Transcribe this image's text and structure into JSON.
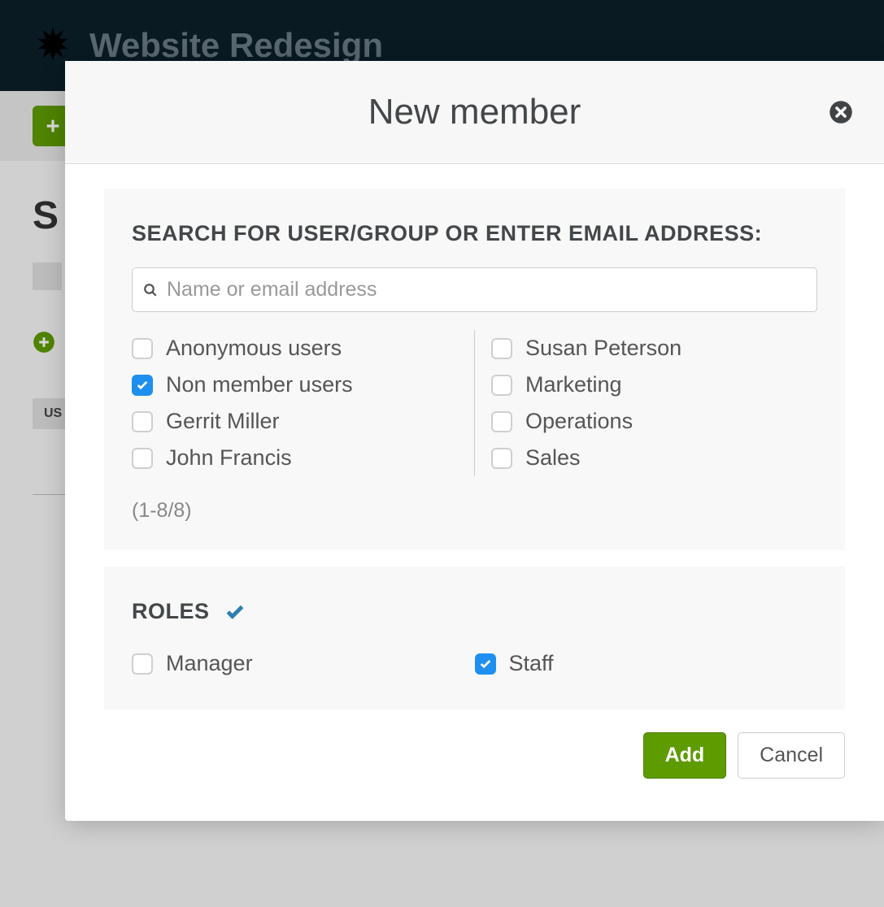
{
  "background": {
    "project_title": "Website Redesign",
    "heading_partial": "S",
    "tab_partial": "",
    "us_tab": "US"
  },
  "modal": {
    "title": "New member",
    "search_section": {
      "label": "SEARCH FOR USER/GROUP OR ENTER EMAIL ADDRESS:",
      "placeholder": "Name or email address",
      "value": ""
    },
    "users_left": [
      {
        "label": "Anonymous users",
        "checked": false
      },
      {
        "label": "Non member users",
        "checked": true
      },
      {
        "label": "Gerrit Miller",
        "checked": false
      },
      {
        "label": "John Francis",
        "checked": false
      }
    ],
    "users_right": [
      {
        "label": "Susan Peterson",
        "checked": false
      },
      {
        "label": "Marketing",
        "checked": false
      },
      {
        "label": "Operations",
        "checked": false
      },
      {
        "label": "Sales",
        "checked": false
      }
    ],
    "result_count": "(1-8/8)",
    "roles_label": "ROLES",
    "roles": [
      {
        "label": "Manager",
        "checked": false
      },
      {
        "label": "Staff",
        "checked": true
      }
    ],
    "buttons": {
      "add": "Add",
      "cancel": "Cancel"
    }
  }
}
